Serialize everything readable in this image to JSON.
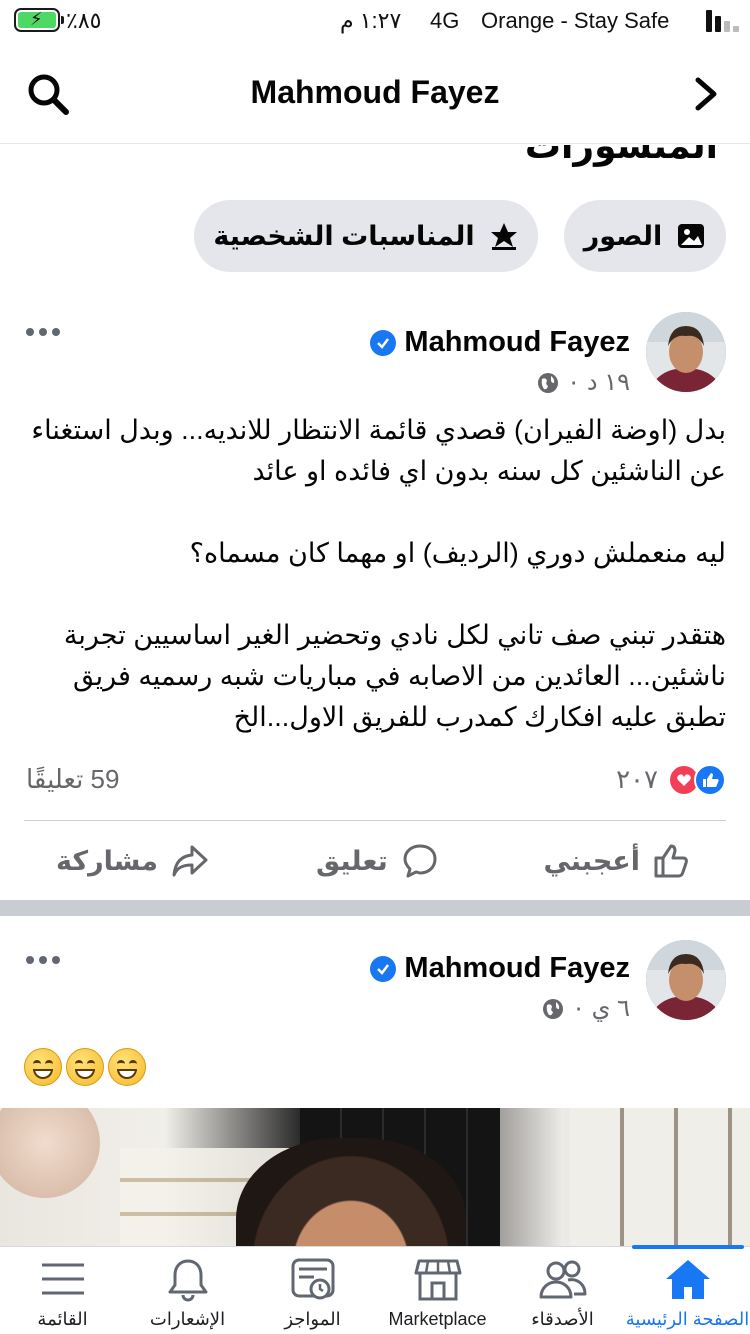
{
  "status_bar": {
    "battery": "٪٨٥",
    "time": "١:٢٧ م",
    "network": "4G",
    "carrier": "Orange - Stay Safe"
  },
  "nav": {
    "title": "Mahmoud Fayez"
  },
  "section": {
    "title": "المنشورات"
  },
  "pills": {
    "photos": "الصور",
    "life_events": "المناسبات الشخصية"
  },
  "posts": [
    {
      "author": "Mahmoud Fayez",
      "time": "١٩ د ٠",
      "text": "بدل (اوضة الفيران) قصدي قائمة الانتظار للانديه... وبدل استغناء عن الناشئين كل سنه بدون اي فائده او عائد\n\nليه منعملش دوري (الرديف) او مهما كان مسماه؟\n\nهتقدر تبني صف تاني لكل نادي وتحضير الغير اساسيين تجربة ناشئين... العائدين من الاصابه في مباريات شبه رسميه فريق تطبق عليه افكارك كمدرب للفريق الاول...الخ",
      "reactions": "٢٠٧",
      "comments": "59 تعليقًا",
      "actions": {
        "like": "أعجبني",
        "comment": "تعليق",
        "share": "مشاركة"
      }
    },
    {
      "author": "Mahmoud Fayez",
      "time": "٦ ي ٠"
    }
  ],
  "tab_bar": [
    {
      "label": "الصفحة الرئيسية",
      "icon": "home-icon"
    },
    {
      "label": "الأصدقاء",
      "icon": "friends-icon"
    },
    {
      "label": "Marketplace",
      "icon": "marketplace-icon"
    },
    {
      "label": "المواجز",
      "icon": "feeds-icon"
    },
    {
      "label": "الإشعارات",
      "icon": "bell-icon"
    },
    {
      "label": "القائمة",
      "icon": "menu-icon"
    }
  ],
  "colors": {
    "accent": "#1877f2",
    "love": "#f33e58",
    "secondary_text": "#65676b",
    "pill_bg": "#e4e6eb"
  }
}
